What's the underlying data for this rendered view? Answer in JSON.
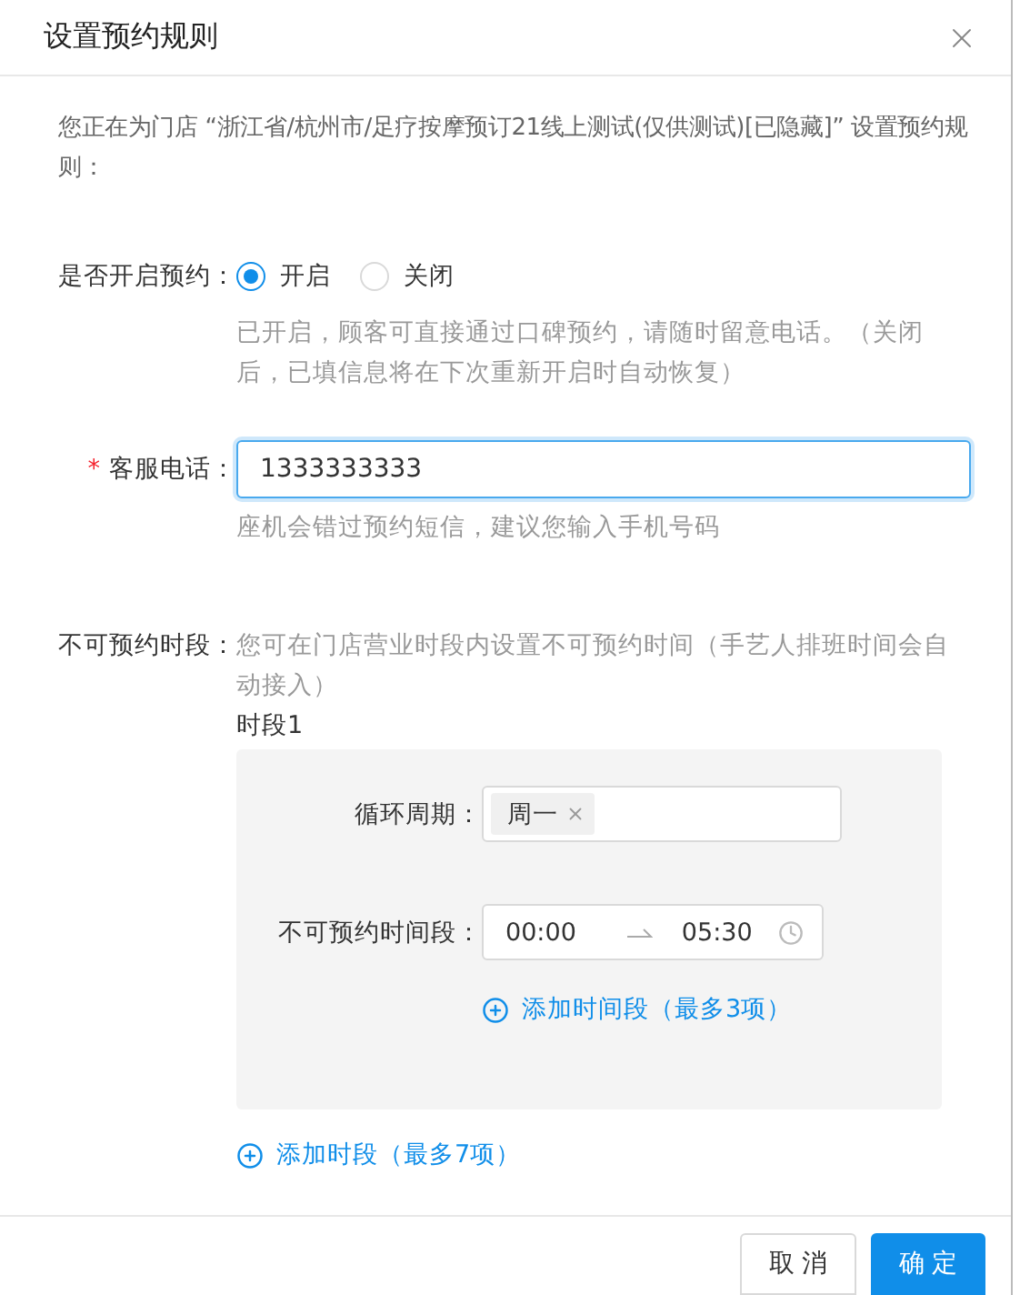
{
  "dialog": {
    "title": "设置预约规则",
    "intro": "您正在为门店 “浙江省/杭州市/足疗按摩预订21线上测试(仅供测试)[已隐藏]” 设置预约规则：",
    "fields": [
      {
        "kind": "radio",
        "label": "是否开启预约：",
        "options": [
          {
            "label": "开启",
            "selected": true
          },
          {
            "label": "关闭",
            "selected": false
          }
        ],
        "hint": "已开启，顾客可直接通过口碑预约，请随时留意电话。（关闭后，已填信息将在下次重新开启时自动恢复）"
      },
      {
        "kind": "text",
        "label": "客服电话：",
        "required_mark": "*",
        "value": "1333333333",
        "focused": true,
        "hint": "座机会错过预约短信，建议您输入手机号码"
      },
      {
        "kind": "periods",
        "label": "不可预约时段：",
        "hint": "您可在门店营业时段内设置不可预约时间（手艺人排班时间会自动接入）",
        "periods": [
          {
            "title": "时段1",
            "cycle_label": "循环周期：",
            "tags": [
              "周一"
            ],
            "time_label": "不可预约时间段：",
            "start": "00:00",
            "end": "05:30",
            "add_time": "添加时间段（最多3项）"
          }
        ],
        "add_period": "添加时段（最多7项）"
      }
    ],
    "buttons": [
      {
        "label": "取 消",
        "primary": false
      },
      {
        "label": "确 定",
        "primary": true
      }
    ]
  }
}
